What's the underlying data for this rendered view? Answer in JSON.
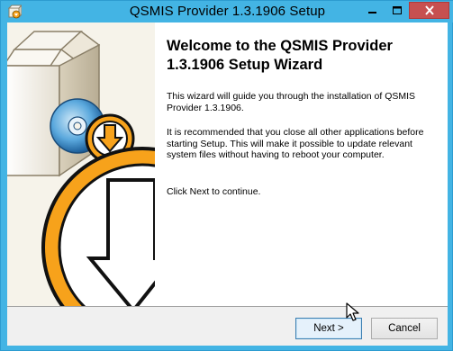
{
  "window": {
    "title": "QSMIS Provider 1.3.1906 Setup",
    "controls": [
      "minimize-icon",
      "maximize-icon",
      "close-icon"
    ],
    "titlebar_color": "#43b4e4",
    "close_color": "#c75050"
  },
  "wizard": {
    "heading": "Welcome to the QSMIS Provider 1.3.1906 Setup Wizard",
    "intro": "This wizard will guide you through the installation of QSMIS Provider 1.3.1906.",
    "recommendation": "It is recommended that you close all other applications before starting Setup. This will make it possible to update relevant system files without having to reboot your computer.",
    "instruction": "Click Next to continue."
  },
  "buttons": {
    "next": "Next >",
    "cancel": "Cancel"
  },
  "colors": {
    "accent_orange": "#f7a21b",
    "focus_blue": "#3c7fb1"
  }
}
